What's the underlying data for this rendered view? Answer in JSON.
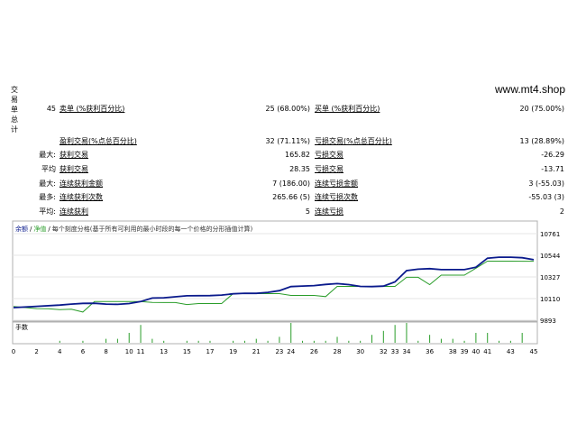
{
  "side_label": "交易单总计",
  "watermark": "www.mt4.shop",
  "report": [
    {
      "label": "45",
      "label2": "卖单 (%获利百分比)",
      "value": "25 (68.00%)",
      "label3": "买单 (%获利百分比)",
      "value3": "20 (75.00%)"
    },
    {
      "label": "",
      "label2": "盈利交易(%点总百分比)",
      "value": "32 (71.11%)",
      "label3": "亏损交易(%点总百分比)",
      "value3": "13 (28.89%)"
    },
    {
      "label": "最大:",
      "label2": "获利交易",
      "value": "165.82",
      "label3": "亏损交易",
      "value3": "-26.29"
    },
    {
      "label": "平均",
      "label2": "获利交易",
      "value": "28.35",
      "label3": "亏损交易",
      "value3": "-13.71"
    },
    {
      "label": "最大:",
      "label2": "连续获利金额",
      "value": "7 (186.00)",
      "label3": "连续亏损金额",
      "value3": "3 (-55.03)"
    },
    {
      "label": "最多:",
      "label2": "连续获利次数",
      "value": "265.66 (5)",
      "label3": "连续亏损次数",
      "value3": "-55.03 (3)"
    },
    {
      "label": "平均:",
      "label2": "连续获利",
      "value": "5",
      "label3": "连续亏损",
      "value3": "2"
    }
  ],
  "chart_data": {
    "type": "line",
    "legend_prefix": "余额",
    "legend_sep1": "/",
    "legend_equity": "净值",
    "legend_sep2": "/",
    "legend_desc": "每个刻度分格(基于所有可利用的最小时段的每一个价格的分形插值计算)",
    "lower_label": "手数",
    "y_ticks": [
      10761,
      10544,
      10327,
      10110,
      9893
    ],
    "ylim": [
      9893,
      10761
    ],
    "xlim": [
      0,
      45
    ],
    "x_ticks": [
      0,
      2,
      4,
      6,
      8,
      10,
      11,
      13,
      15,
      17,
      19,
      21,
      23,
      24,
      26,
      28,
      30,
      32,
      33,
      34,
      36,
      38,
      39,
      40,
      41,
      43,
      45
    ],
    "x_tick_labels": [
      "0",
      "2",
      "4",
      "6",
      "8",
      "10",
      "11",
      "13",
      "15",
      "17",
      "19",
      "21",
      "23",
      "24",
      "26",
      "28",
      "30",
      "32",
      "33",
      "34",
      "36",
      "38",
      "39",
      "40",
      "41",
      "43",
      "45"
    ],
    "series": [
      {
        "color": "#0a1a8c",
        "points": [
          [
            0,
            10020
          ],
          [
            2,
            10032
          ],
          [
            4,
            10045
          ],
          [
            5,
            10055
          ],
          [
            6,
            10062
          ],
          [
            7,
            10063
          ],
          [
            8,
            10055
          ],
          [
            9,
            10052
          ],
          [
            10,
            10060
          ],
          [
            11,
            10080
          ],
          [
            12,
            10115
          ],
          [
            13,
            10118
          ],
          [
            14,
            10128
          ],
          [
            15,
            10138
          ],
          [
            17,
            10140
          ],
          [
            18,
            10145
          ],
          [
            19,
            10158
          ],
          [
            20,
            10163
          ],
          [
            21,
            10162
          ],
          [
            22,
            10172
          ],
          [
            23,
            10190
          ],
          [
            24,
            10230
          ],
          [
            25,
            10236
          ],
          [
            26,
            10240
          ],
          [
            27,
            10252
          ],
          [
            28,
            10260
          ],
          [
            29,
            10250
          ],
          [
            30,
            10232
          ],
          [
            31,
            10230
          ],
          [
            32,
            10235
          ],
          [
            33,
            10277
          ],
          [
            34,
            10390
          ],
          [
            35,
            10405
          ],
          [
            36,
            10410
          ],
          [
            37,
            10400
          ],
          [
            38,
            10400
          ],
          [
            39,
            10400
          ],
          [
            40,
            10425
          ],
          [
            41,
            10515
          ],
          [
            42,
            10525
          ],
          [
            43,
            10525
          ],
          [
            44,
            10520
          ],
          [
            45,
            10500
          ]
        ]
      },
      {
        "color": "#2a9d2a",
        "points": [
          [
            0,
            10030
          ],
          [
            2,
            10010
          ],
          [
            3,
            10008
          ],
          [
            4,
            10000
          ],
          [
            5,
            10003
          ],
          [
            6,
            9975
          ],
          [
            7,
            10080
          ],
          [
            10,
            10080
          ],
          [
            11,
            10080
          ],
          [
            12,
            10072
          ],
          [
            13,
            10070
          ],
          [
            14,
            10070
          ],
          [
            15,
            10050
          ],
          [
            16,
            10060
          ],
          [
            17,
            10060
          ],
          [
            18,
            10060
          ],
          [
            19,
            10160
          ],
          [
            20,
            10160
          ],
          [
            23,
            10160
          ],
          [
            24,
            10142
          ],
          [
            25,
            10142
          ],
          [
            26,
            10142
          ],
          [
            27,
            10130
          ],
          [
            28,
            10232
          ],
          [
            29,
            10232
          ],
          [
            33,
            10232
          ],
          [
            34,
            10323
          ],
          [
            35,
            10323
          ],
          [
            36,
            10250
          ],
          [
            37,
            10345
          ],
          [
            38,
            10345
          ],
          [
            39,
            10345
          ],
          [
            40,
            10415
          ],
          [
            41,
            10485
          ],
          [
            42,
            10485
          ],
          [
            43,
            10485
          ],
          [
            44,
            10484
          ],
          [
            45,
            10484
          ]
        ]
      }
    ],
    "volumes": [
      {
        "x": 4,
        "v": 1
      },
      {
        "x": 6,
        "v": 1
      },
      {
        "x": 8,
        "v": 2
      },
      {
        "x": 9,
        "v": 2
      },
      {
        "x": 10,
        "v": 5
      },
      {
        "x": 11,
        "v": 9
      },
      {
        "x": 12,
        "v": 2
      },
      {
        "x": 13,
        "v": 1
      },
      {
        "x": 15,
        "v": 1
      },
      {
        "x": 16,
        "v": 1
      },
      {
        "x": 17,
        "v": 1
      },
      {
        "x": 19,
        "v": 1
      },
      {
        "x": 20,
        "v": 1
      },
      {
        "x": 21,
        "v": 2
      },
      {
        "x": 22,
        "v": 1
      },
      {
        "x": 23,
        "v": 3
      },
      {
        "x": 24,
        "v": 10
      },
      {
        "x": 25,
        "v": 1
      },
      {
        "x": 26,
        "v": 1
      },
      {
        "x": 27,
        "v": 1
      },
      {
        "x": 28,
        "v": 3
      },
      {
        "x": 29,
        "v": 1
      },
      {
        "x": 30,
        "v": 1
      },
      {
        "x": 31,
        "v": 4
      },
      {
        "x": 32,
        "v": 6
      },
      {
        "x": 33,
        "v": 9
      },
      {
        "x": 34,
        "v": 10
      },
      {
        "x": 35,
        "v": 1
      },
      {
        "x": 36,
        "v": 4
      },
      {
        "x": 37,
        "v": 2
      },
      {
        "x": 38,
        "v": 2
      },
      {
        "x": 39,
        "v": 1
      },
      {
        "x": 40,
        "v": 5
      },
      {
        "x": 41,
        "v": 5
      },
      {
        "x": 42,
        "v": 1
      },
      {
        "x": 43,
        "v": 1
      },
      {
        "x": 44,
        "v": 5
      }
    ]
  }
}
